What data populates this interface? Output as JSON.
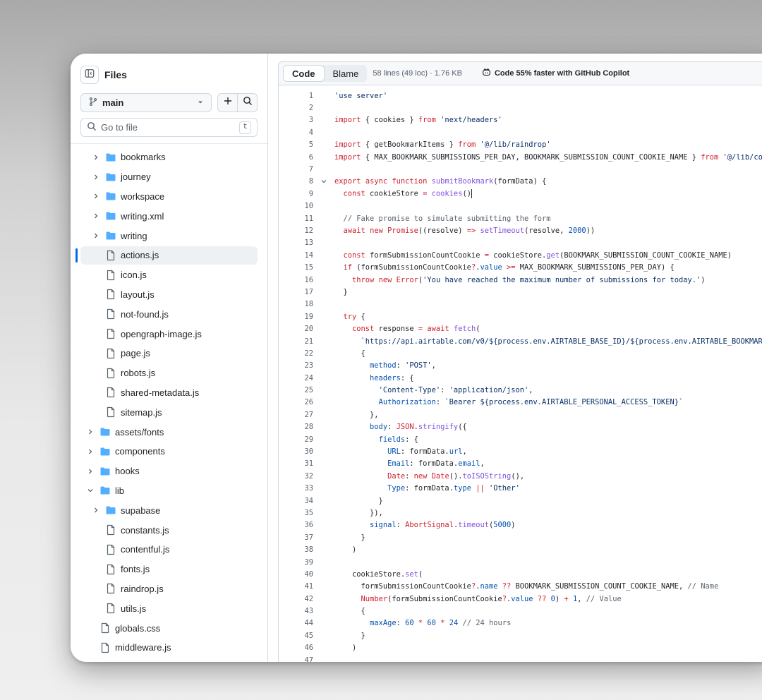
{
  "sidebar": {
    "title": "Files",
    "branch": "main",
    "search_placeholder": "Go to file",
    "search_shortcut": "t",
    "tree": [
      {
        "label": "bookmarks",
        "type": "folder",
        "depth": 1,
        "expanded": false
      },
      {
        "label": "journey",
        "type": "folder",
        "depth": 1,
        "expanded": false
      },
      {
        "label": "workspace",
        "type": "folder",
        "depth": 1,
        "expanded": false
      },
      {
        "label": "writing.xml",
        "type": "folder",
        "depth": 1,
        "expanded": false
      },
      {
        "label": "writing",
        "type": "folder",
        "depth": 1,
        "expanded": false
      },
      {
        "label": "actions.js",
        "type": "file",
        "depth": 1,
        "selected": true
      },
      {
        "label": "icon.js",
        "type": "file",
        "depth": 1
      },
      {
        "label": "layout.js",
        "type": "file",
        "depth": 1
      },
      {
        "label": "not-found.js",
        "type": "file",
        "depth": 1
      },
      {
        "label": "opengraph-image.js",
        "type": "file",
        "depth": 1
      },
      {
        "label": "page.js",
        "type": "file",
        "depth": 1
      },
      {
        "label": "robots.js",
        "type": "file",
        "depth": 1
      },
      {
        "label": "shared-metadata.js",
        "type": "file",
        "depth": 1
      },
      {
        "label": "sitemap.js",
        "type": "file",
        "depth": 1
      },
      {
        "label": "assets/fonts",
        "type": "folder",
        "depth": 0,
        "expanded": false
      },
      {
        "label": "components",
        "type": "folder",
        "depth": 0,
        "expanded": false
      },
      {
        "label": "hooks",
        "type": "folder",
        "depth": 0,
        "expanded": false
      },
      {
        "label": "lib",
        "type": "folder",
        "depth": 0,
        "expanded": true
      },
      {
        "label": "supabase",
        "type": "folder",
        "depth": 1,
        "expanded": false
      },
      {
        "label": "constants.js",
        "type": "file",
        "depth": 1
      },
      {
        "label": "contentful.js",
        "type": "file",
        "depth": 1
      },
      {
        "label": "fonts.js",
        "type": "file",
        "depth": 1
      },
      {
        "label": "raindrop.js",
        "type": "file",
        "depth": 1
      },
      {
        "label": "utils.js",
        "type": "file",
        "depth": 1
      },
      {
        "label": "globals.css",
        "type": "file",
        "depth": 0
      },
      {
        "label": "middleware.js",
        "type": "file",
        "depth": 0
      }
    ]
  },
  "toolbar": {
    "code_tab": "Code",
    "blame_tab": "Blame",
    "file_meta": "58 lines (49 loc) · 1.76 KB",
    "copilot_text": "Code 55% faster with GitHub Copilot"
  },
  "code": [
    {
      "n": "1",
      "t": "'use server'"
    },
    {
      "n": "2",
      "t": ""
    },
    {
      "n": "3",
      "t": "import { cookies } from 'next/headers'"
    },
    {
      "n": "4",
      "t": ""
    },
    {
      "n": "5",
      "t": "import { getBookmarkItems } from '@/lib/raindrop'"
    },
    {
      "n": "6",
      "t": "import { MAX_BOOKMARK_SUBMISSIONS_PER_DAY, BOOKMARK_SUBMISSION_COUNT_COOKIE_NAME } from '@/lib/co"
    },
    {
      "n": "7",
      "t": ""
    },
    {
      "n": "8",
      "t": "export async function submitBookmark(formData) {",
      "fold": true
    },
    {
      "n": "9",
      "t": "  const cookieStore = cookies()",
      "caret": true
    },
    {
      "n": "10",
      "t": ""
    },
    {
      "n": "11",
      "t": "  // Fake promise to simulate submitting the form"
    },
    {
      "n": "12",
      "t": "  await new Promise((resolve) => setTimeout(resolve, 2000))"
    },
    {
      "n": "13",
      "t": ""
    },
    {
      "n": "14",
      "t": "  const formSubmissionCountCookie = cookieStore.get(BOOKMARK_SUBMISSION_COUNT_COOKIE_NAME)"
    },
    {
      "n": "15",
      "t": "  if (formSubmissionCountCookie?.value >= MAX_BOOKMARK_SUBMISSIONS_PER_DAY) {"
    },
    {
      "n": "16",
      "t": "    throw new Error('You have reached the maximum number of submissions for today.')"
    },
    {
      "n": "17",
      "t": "  }"
    },
    {
      "n": "18",
      "t": ""
    },
    {
      "n": "19",
      "t": "  try {"
    },
    {
      "n": "20",
      "t": "    const response = await fetch("
    },
    {
      "n": "21",
      "t": "      `https://api.airtable.com/v0/${process.env.AIRTABLE_BASE_ID}/${process.env.AIRTABLE_BOOKMAR"
    },
    {
      "n": "22",
      "t": "      {"
    },
    {
      "n": "23",
      "t": "        method: 'POST',"
    },
    {
      "n": "24",
      "t": "        headers: {"
    },
    {
      "n": "25",
      "t": "          'Content-Type': 'application/json',"
    },
    {
      "n": "26",
      "t": "          Authorization: `Bearer ${process.env.AIRTABLE_PERSONAL_ACCESS_TOKEN}`"
    },
    {
      "n": "27",
      "t": "        },"
    },
    {
      "n": "28",
      "t": "        body: JSON.stringify({"
    },
    {
      "n": "29",
      "t": "          fields: {"
    },
    {
      "n": "30",
      "t": "            URL: formData.url,"
    },
    {
      "n": "31",
      "t": "            Email: formData.email,"
    },
    {
      "n": "32",
      "t": "            Date: new Date().toISOString(),"
    },
    {
      "n": "33",
      "t": "            Type: formData.type || 'Other'"
    },
    {
      "n": "34",
      "t": "          }"
    },
    {
      "n": "35",
      "t": "        }),"
    },
    {
      "n": "36",
      "t": "        signal: AbortSignal.timeout(5000)"
    },
    {
      "n": "37",
      "t": "      }"
    },
    {
      "n": "38",
      "t": "    )"
    },
    {
      "n": "39",
      "t": ""
    },
    {
      "n": "40",
      "t": "    cookieStore.set("
    },
    {
      "n": "41",
      "t": "      formSubmissionCountCookie?.name ?? BOOKMARK_SUBMISSION_COUNT_COOKIE_NAME, // Name"
    },
    {
      "n": "42",
      "t": "      Number(formSubmissionCountCookie?.value ?? 0) + 1, // Value"
    },
    {
      "n": "43",
      "t": "      {"
    },
    {
      "n": "44",
      "t": "        maxAge: 60 * 60 * 24 // 24 hours"
    },
    {
      "n": "45",
      "t": "      }"
    },
    {
      "n": "46",
      "t": "    )"
    },
    {
      "n": "47",
      "t": ""
    }
  ],
  "colors": {
    "accent": "#0969da",
    "folder": "#54aeff",
    "keyword": "#cf222e",
    "string": "#0a3069",
    "function": "#8250df",
    "comment": "#59636e",
    "property": "#0550ae"
  },
  "icons": {
    "panel": "sidebar-panel-icon",
    "branch": "git-branch-icon",
    "dropdown": "triangle-down-icon",
    "add": "plus-icon",
    "search": "search-icon",
    "folder": "folder-icon",
    "file": "file-icon",
    "copilot": "copilot-icon"
  }
}
